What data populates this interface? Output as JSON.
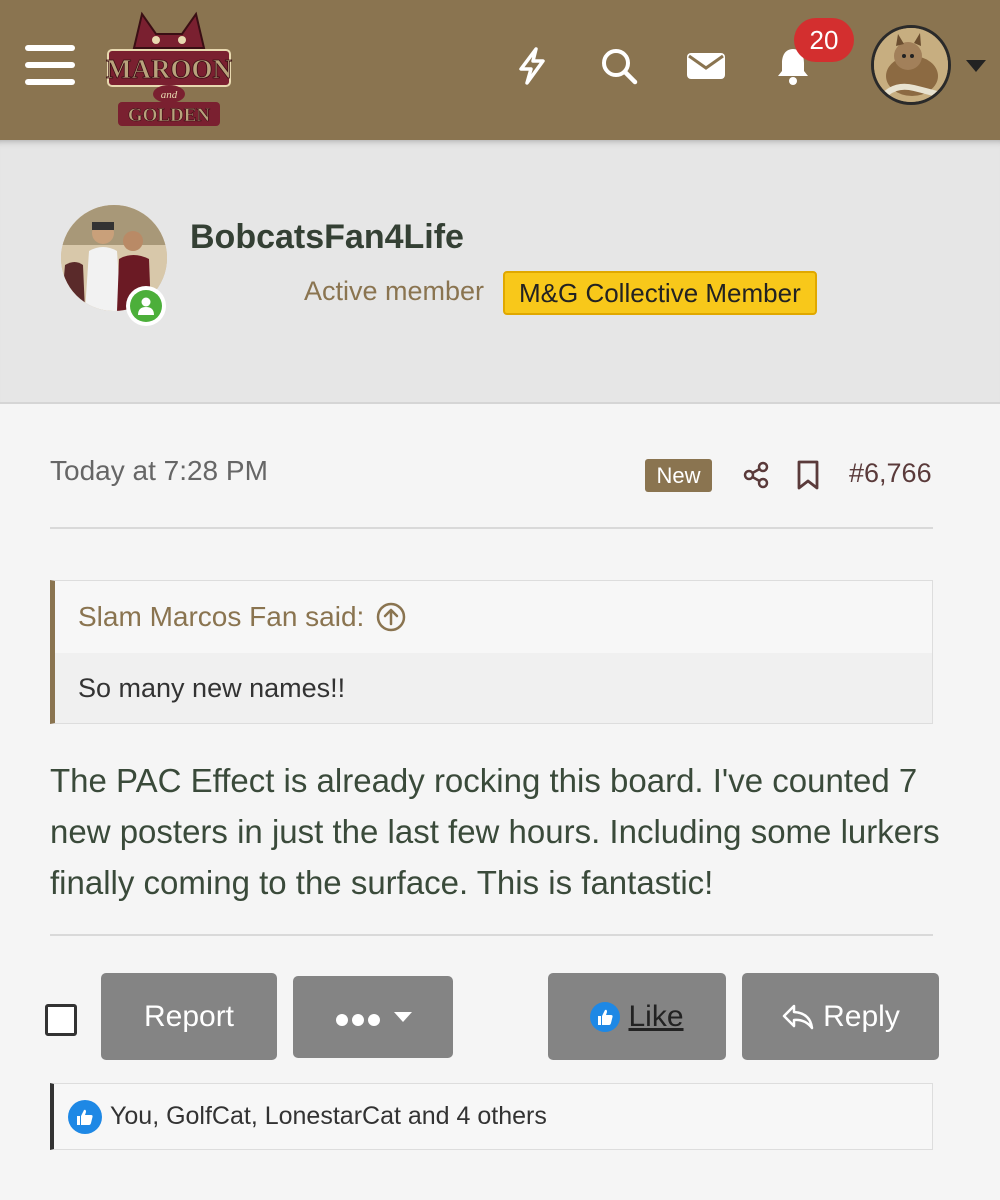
{
  "header": {
    "logo_text_top": "MAROON",
    "logo_text_mid": "and",
    "logo_text_bottom": "GOLDEN",
    "notification_count": "20"
  },
  "post": {
    "author": "BobcatsFan4Life",
    "user_title": "Active member",
    "user_banner": "M&G Collective Member",
    "date": "Today at 7:28 PM",
    "new_label": "New",
    "post_number": "#6,766",
    "quote": {
      "author_said": "Slam Marcos Fan said:",
      "text": "So many new names!!"
    },
    "body": "The PAC Effect is already rocking this board. I've counted 7 new posters in just the last few hours. Including some lurkers finally coming to the surface. This is fantastic!",
    "actions": {
      "report": "Report",
      "like": "Like",
      "reply": "Reply"
    },
    "reactions": "You, GolfCat, LonestarCat and 4 others"
  },
  "colors": {
    "header_bg": "#8a7450",
    "badge_red": "#d32f2f",
    "banner_yellow": "#f8c81a",
    "online_green": "#4caf3a",
    "like_blue": "#1e88e5"
  },
  "icons": [
    "menu-icon",
    "lightning-icon",
    "search-icon",
    "mail-icon",
    "bell-icon",
    "share-icon",
    "bookmark-icon",
    "arrow-up-circle-icon",
    "thumbs-up-icon",
    "reply-icon",
    "user-icon"
  ]
}
